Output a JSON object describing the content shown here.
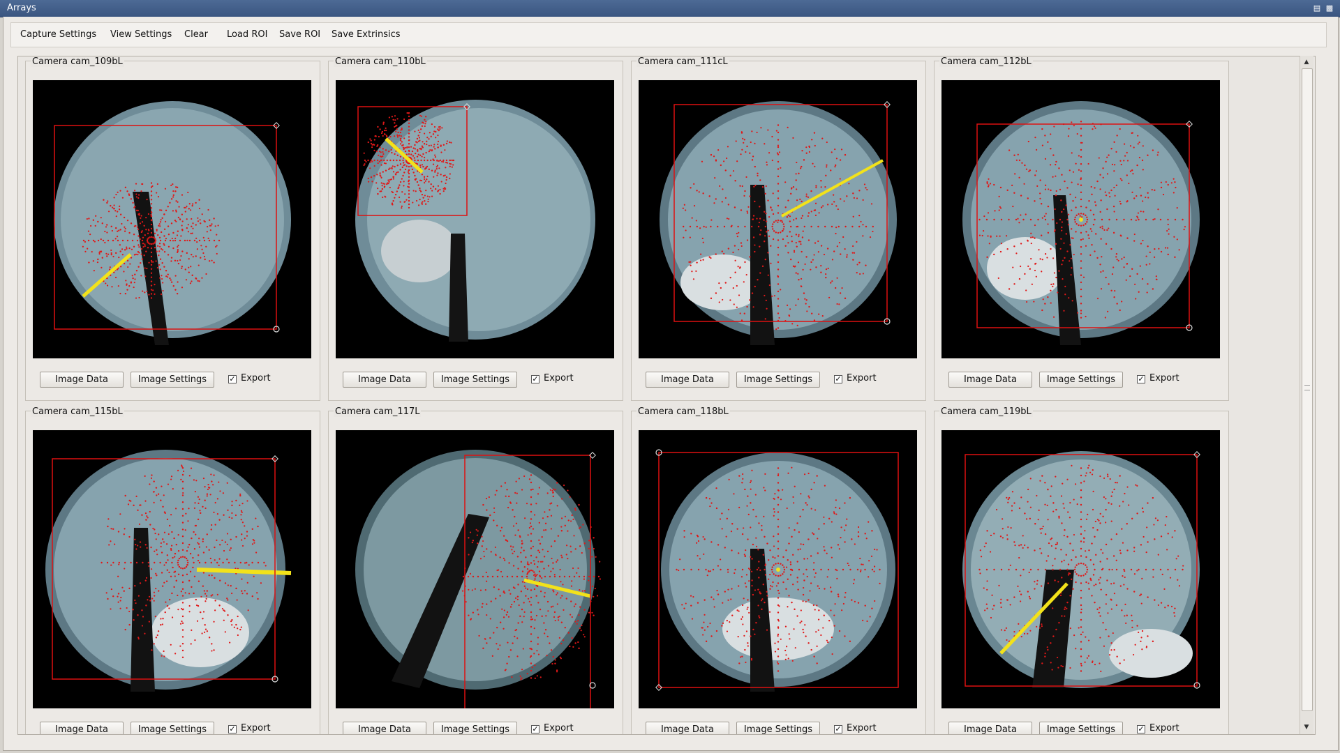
{
  "window": {
    "title": "Arrays"
  },
  "menu": [
    "Capture Settings",
    "View Settings",
    "Clear",
    "Load ROI",
    "Save ROI",
    "Save Extrinsics"
  ],
  "buttons": {
    "image_data": "Image Data",
    "image_settings": "Image Settings",
    "export": "Export",
    "export_checked": true
  },
  "cameras": [
    {
      "name": "Camera cam_109bL"
    },
    {
      "name": "Camera cam_110bL"
    },
    {
      "name": "Camera cam_111cL"
    },
    {
      "name": "Camera cam_112bL"
    },
    {
      "name": "Camera cam_115bL"
    },
    {
      "name": "Camera cam_117L"
    },
    {
      "name": "Camera cam_118bL"
    },
    {
      "name": "Camera cam_119bL"
    }
  ],
  "colors": {
    "roi": "#d11",
    "dots": "#e01818",
    "sun_line": "#f2e21a",
    "sky": "#7f9ba4",
    "titlebar": "#3f5a86"
  }
}
